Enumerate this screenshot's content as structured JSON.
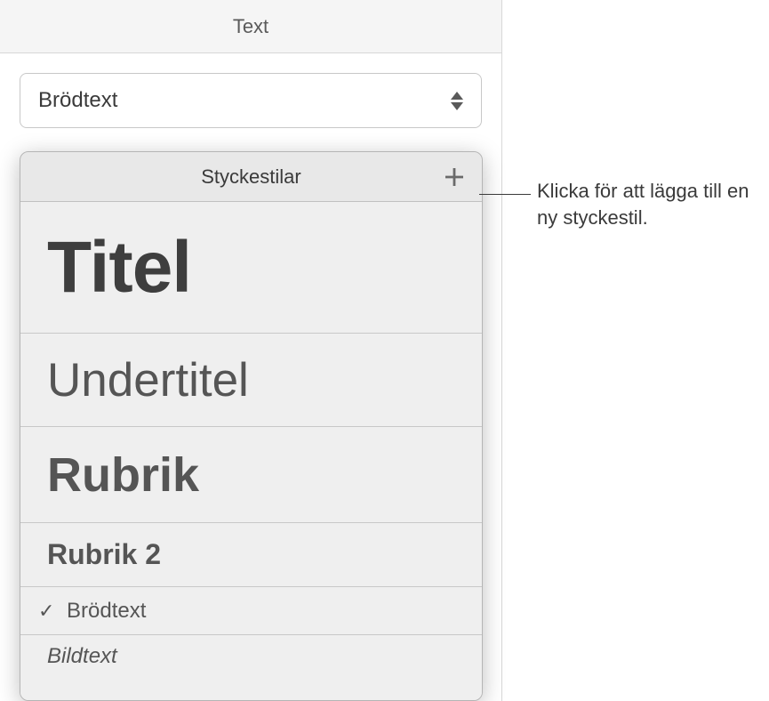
{
  "header": {
    "title": "Text"
  },
  "dropdown": {
    "current": "Brödtext"
  },
  "popover": {
    "title": "Styckestilar",
    "styles": {
      "titel": "Titel",
      "undertitel": "Undertitel",
      "rubrik": "Rubrik",
      "rubrik2": "Rubrik 2",
      "brodtext": "Brödtext",
      "bildtext": "Bildtext"
    },
    "checkmark": "✓"
  },
  "callout": {
    "text": "Klicka för att lägga till en ny styckestil."
  }
}
